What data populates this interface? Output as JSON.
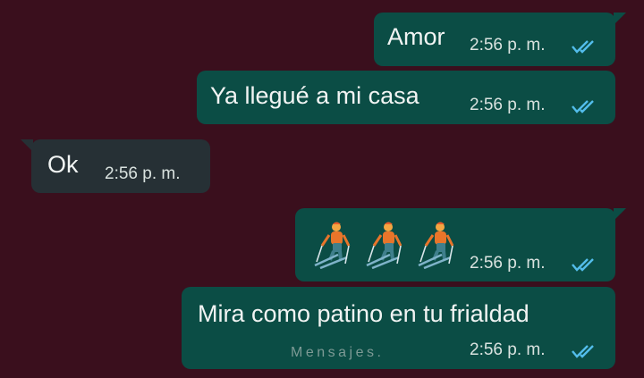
{
  "messages": [
    {
      "text": "Amor",
      "time": "2:56 p. m.",
      "direction": "outgoing",
      "status": "read"
    },
    {
      "text": "Ya llegué a mi casa",
      "time": "2:56 p. m.",
      "direction": "outgoing",
      "status": "read"
    },
    {
      "text": "Ok",
      "time": "2:56 p. m.",
      "direction": "incoming"
    },
    {
      "text": "",
      "time": "2:56 p. m.",
      "direction": "outgoing",
      "status": "read",
      "emoji": [
        "skier-icon",
        "skier-icon",
        "skier-icon"
      ]
    },
    {
      "text": "Mira como patino en tu frialdad",
      "time": "2:56 p. m.",
      "direction": "outgoing",
      "status": "read"
    }
  ],
  "watermark": "Mensajes.",
  "colors": {
    "background": "#3a0f1d",
    "outgoing_bubble": "#0b4d45",
    "incoming_bubble": "#263035",
    "read_ticks": "#53bdeb"
  }
}
